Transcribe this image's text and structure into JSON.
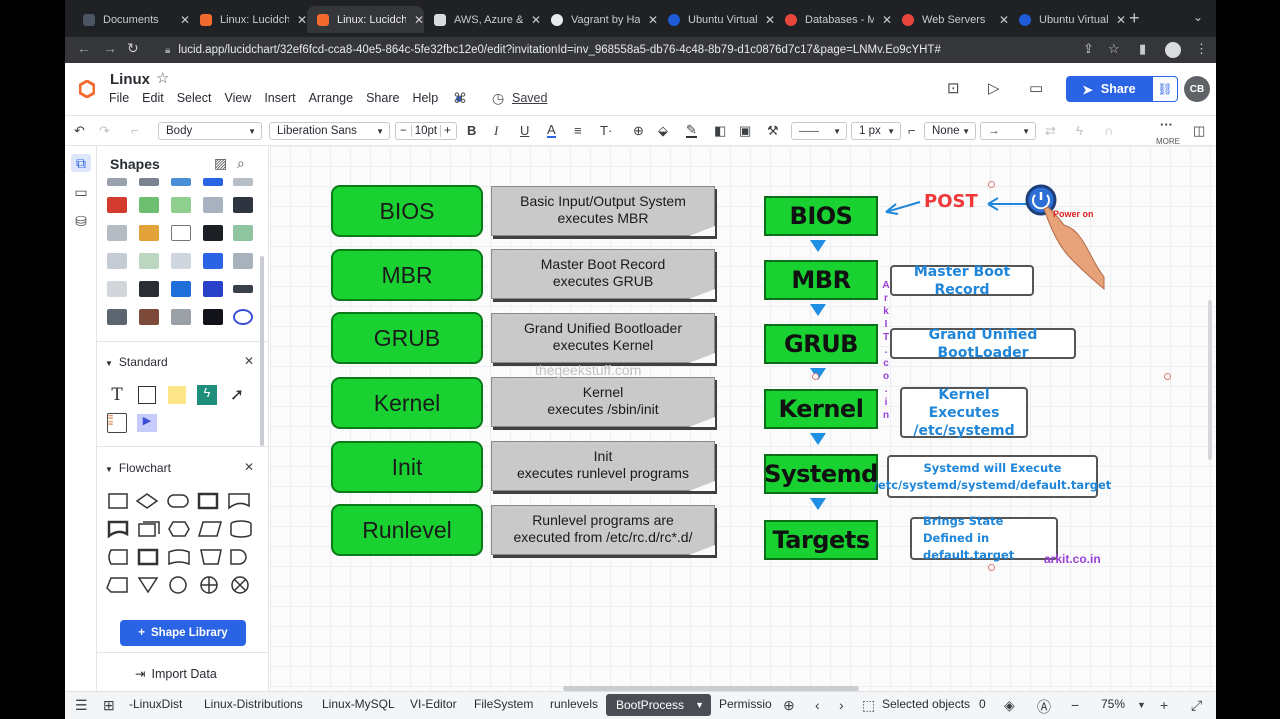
{
  "browser": {
    "tabs": [
      {
        "title": "Documents",
        "color": "#4b5563"
      },
      {
        "title": "Linux: Lucidchart",
        "color": "#f26a2e"
      },
      {
        "title": "Linux: Lucidchart",
        "color": "#f26a2e"
      },
      {
        "title": "AWS, Azure & GCP",
        "color": "#d8dade"
      },
      {
        "title": "Vagrant by HashiCorp",
        "color": "#e8eaed"
      },
      {
        "title": "Ubuntu Virtual Machine",
        "color": "#1f5bd6"
      },
      {
        "title": "Databases - M",
        "color": "#e8453c"
      },
      {
        "title": "Web Servers",
        "color": "#e8453c"
      },
      {
        "title": "Ubuntu Virtual Machine",
        "color": "#1f5bd6"
      }
    ],
    "url": "lucid.app/lucidchart/32ef6fcd-cca8-40e5-864c-5fe32fbc12e0/edit?invitationId=inv_968558a5-db76-4c48-8b79-d1c0876d7c17&page=LNMv.Eo9cYHT#"
  },
  "header": {
    "title": "Linux",
    "menu": [
      "File",
      "Edit",
      "Select",
      "View",
      "Insert",
      "Arrange",
      "Share",
      "Help"
    ],
    "saved": "Saved",
    "share": "Share",
    "avatar": "CB"
  },
  "toolbar": {
    "style": "Body",
    "font": "Liberation Sans",
    "size": "10pt",
    "line_width": "1 px",
    "arrow_start": "None",
    "more": "MORE"
  },
  "panel": {
    "title": "Shapes",
    "sections": [
      "Standard",
      "Flowchart"
    ],
    "shape_library": "Shape Library",
    "import_data": "Import Data"
  },
  "diagram": {
    "left_boxes": [
      "BIOS",
      "MBR",
      "GRUB",
      "Kernel",
      "Init",
      "Runlevel"
    ],
    "notes": [
      [
        "Basic Input/Output System",
        "executes MBR"
      ],
      [
        "Master Boot Record",
        "executes GRUB"
      ],
      [
        "Grand Unified Bootloader",
        "executes Kernel"
      ],
      [
        "Kernel",
        "executes /sbin/init"
      ],
      [
        "Init",
        "executes runlevel programs"
      ],
      [
        "Runlevel programs are",
        "executed from /etc/rc.d/rc*.d/"
      ]
    ],
    "watermark": "thegeekstuff.com",
    "right_boxes": [
      "BIOS",
      "MBR",
      "GRUB",
      "Kernel",
      "Systemd",
      "Targets"
    ],
    "right_labels": [
      [
        "Master Boot Record"
      ],
      [
        "Grand Unified BootLoader"
      ],
      [
        "Kernel Executes",
        "/etc/systemd"
      ],
      [
        "Systemd will Execute",
        "/etc/systemd/systemd/default.target"
      ],
      [
        "Brings State Defined in",
        "default.target"
      ]
    ],
    "post": "POST",
    "power_on": "Power on",
    "arkit_vertical": [
      "A",
      "r",
      "k",
      "I",
      "T",
      ".",
      "c",
      "o",
      ".",
      "i",
      "n"
    ],
    "arkit": "arkit.co.in"
  },
  "bottom": {
    "pages": [
      "-LinuxDist",
      "Linux-Distributions",
      "Linux-MySQL",
      "VI-Editor",
      "FileSystem",
      "runlevels"
    ],
    "active_page": "BootProcess",
    "next_page": "Permissio",
    "selected_label": "Selected objects",
    "selected_count": "0",
    "zoom": "75%"
  }
}
